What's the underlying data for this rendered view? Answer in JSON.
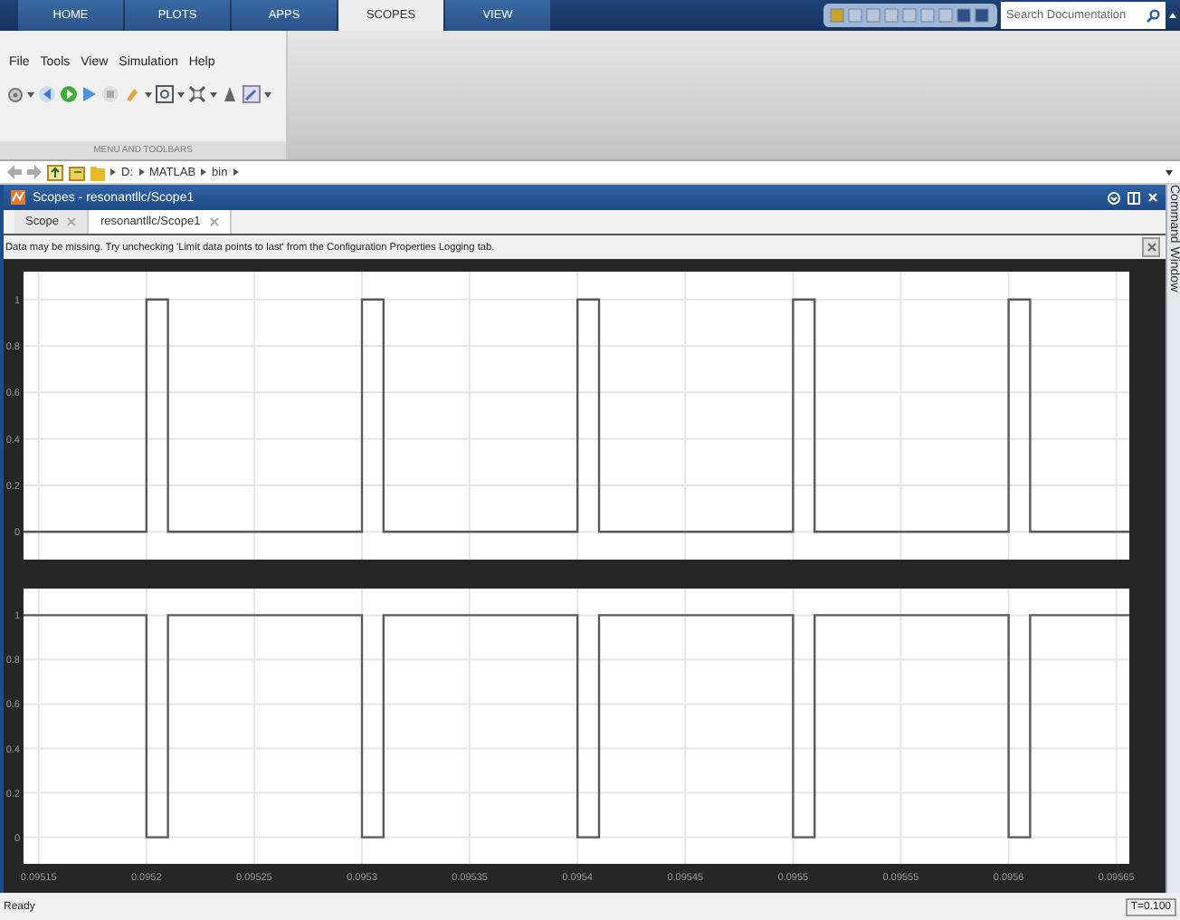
{
  "toolstrip": {
    "tabs": [
      {
        "label": "HOME",
        "selected": false
      },
      {
        "label": "PLOTS",
        "selected": false
      },
      {
        "label": "APPS",
        "selected": false
      },
      {
        "label": "SCOPES",
        "selected": true
      },
      {
        "label": "VIEW",
        "selected": false
      }
    ],
    "search": {
      "placeholder": "Search Documentation"
    }
  },
  "ribbon": {
    "menu": [
      "File",
      "Tools",
      "View",
      "Simulation",
      "Help"
    ],
    "section_label": "MENU AND TOOLBARS"
  },
  "address_bar": {
    "path": [
      "D:",
      "MATLAB",
      "bin"
    ]
  },
  "scope_window": {
    "title": "Scopes - resonantllc/Scope1",
    "tabs": [
      {
        "label": "Scope",
        "selected": false
      },
      {
        "label": "resonantllc/Scope1",
        "selected": true
      }
    ],
    "message": "Data may be missing.  Try unchecking 'Limit data points to last' from the Configuration Properties Logging tab.",
    "plots": [
      {
        "chart_data": {
          "type": "line",
          "grid": true,
          "xlim": [
            0.095143,
            0.095656
          ],
          "ylim": [
            -0.12,
            1.12
          ],
          "yticks": [
            0,
            0.2,
            0.4,
            0.6,
            0.8,
            1
          ],
          "x": [
            0.095143,
            0.0952,
            0.0952,
            0.09521,
            0.09521,
            0.0953,
            0.0953,
            0.09531,
            0.09531,
            0.0954,
            0.0954,
            0.09541,
            0.09541,
            0.0955,
            0.0955,
            0.09551,
            0.09551,
            0.0956,
            0.0956,
            0.09561,
            0.09561,
            0.095656
          ],
          "series": [
            {
              "color": "#5a5a5a",
              "values": [
                0,
                0,
                1,
                1,
                0,
                0,
                1,
                1,
                0,
                0,
                1,
                1,
                0,
                0,
                1,
                1,
                0,
                0,
                1,
                1,
                0,
                0
              ]
            }
          ]
        }
      },
      {
        "chart_data": {
          "type": "line",
          "grid": true,
          "xlim": [
            0.095143,
            0.095656
          ],
          "ylim": [
            -0.12,
            1.12
          ],
          "yticks": [
            0,
            0.2,
            0.4,
            0.6,
            0.8,
            1
          ],
          "xticks": [
            {
              "value": 0.09515,
              "label": "0.09515"
            },
            {
              "value": 0.0952,
              "label": "0.0952"
            },
            {
              "value": 0.09525,
              "label": "0.09525"
            },
            {
              "value": 0.0953,
              "label": "0.0953"
            },
            {
              "value": 0.09535,
              "label": "0.09535"
            },
            {
              "value": 0.0954,
              "label": "0.0954"
            },
            {
              "value": 0.09545,
              "label": "0.09545"
            },
            {
              "value": 0.0955,
              "label": "0.0955"
            },
            {
              "value": 0.09555,
              "label": "0.09555"
            },
            {
              "value": 0.0956,
              "label": "0.0956"
            },
            {
              "value": 0.09565,
              "label": "0.09565"
            }
          ],
          "x": [
            0.095143,
            0.0952,
            0.0952,
            0.09521,
            0.09521,
            0.0953,
            0.0953,
            0.09531,
            0.09531,
            0.0954,
            0.0954,
            0.09541,
            0.09541,
            0.0955,
            0.0955,
            0.09551,
            0.09551,
            0.0956,
            0.0956,
            0.09561,
            0.09561,
            0.095656
          ],
          "series": [
            {
              "color": "#5a5a5a",
              "values": [
                1,
                1,
                0,
                0,
                1,
                1,
                0,
                0,
                1,
                1,
                0,
                0,
                1,
                1,
                0,
                0,
                1,
                1,
                0,
                0,
                1,
                1
              ]
            }
          ]
        }
      }
    ]
  },
  "side_panel": {
    "title": "Command Window"
  },
  "status_bar": {
    "status": "Ready",
    "time": "T=0.100"
  }
}
